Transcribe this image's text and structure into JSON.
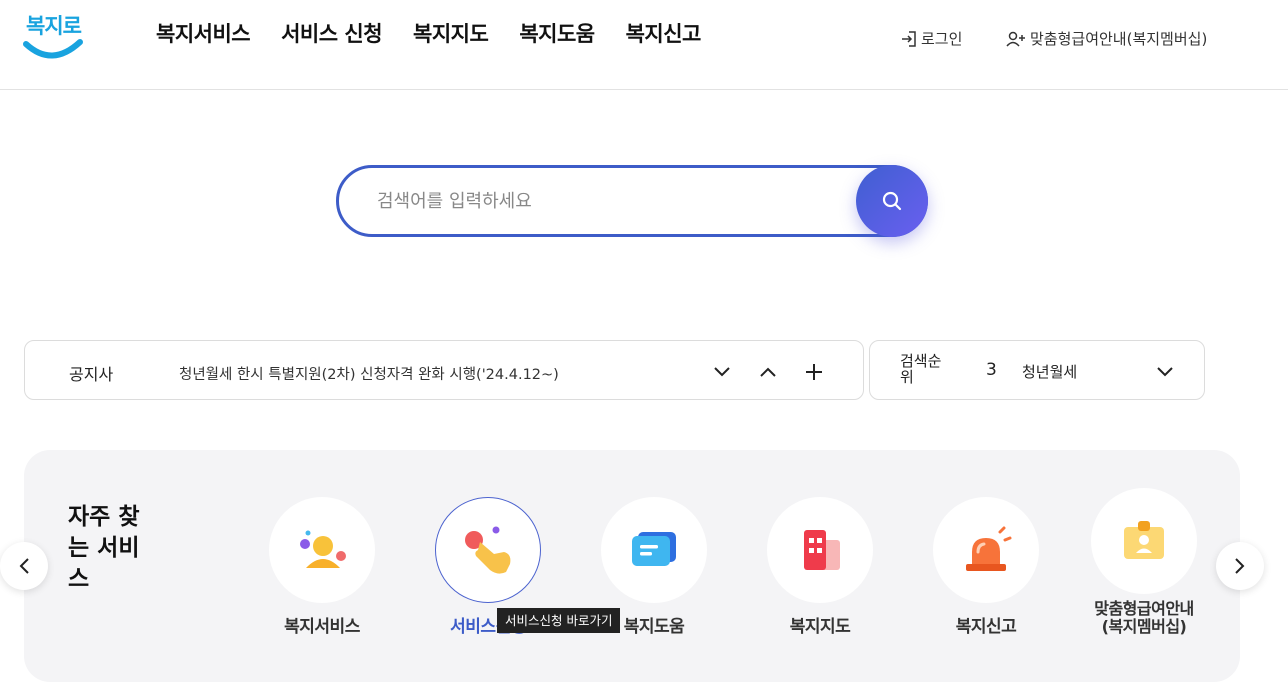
{
  "header": {
    "logo_text": "복지로",
    "nav": [
      "복지서비스",
      "서비스 신청",
      "복지지도",
      "복지도움",
      "복지신고"
    ],
    "login_label": "로그인",
    "member_label": "맞춤형급여안내(복지멤버십)"
  },
  "search": {
    "placeholder": "검색어를 입력하세요"
  },
  "notice": {
    "label": "공지사",
    "text": "청년월세 한시 특별지원(2차) 신청자격 완화 시행('24.4.12~)"
  },
  "ranking": {
    "label": "검색순위",
    "number": "3",
    "keyword": "청년월세"
  },
  "frequent": {
    "title": "자주 찾는 서비스",
    "items": [
      {
        "label": "복지서비스",
        "icon": "people-icon"
      },
      {
        "label": "서비스신청",
        "icon": "hand-tap-icon"
      },
      {
        "label": "복지도움",
        "icon": "chat-icon"
      },
      {
        "label": "복지지도",
        "icon": "building-icon"
      },
      {
        "label": "복지신고",
        "icon": "siren-icon"
      },
      {
        "label": "맞춤형급여안내(복지멤버십)",
        "icon": "id-badge-icon"
      }
    ],
    "tooltip": "서비스신청 바로가기"
  },
  "colors": {
    "accent": "#3d5cc8",
    "logo": "#19a3df"
  }
}
